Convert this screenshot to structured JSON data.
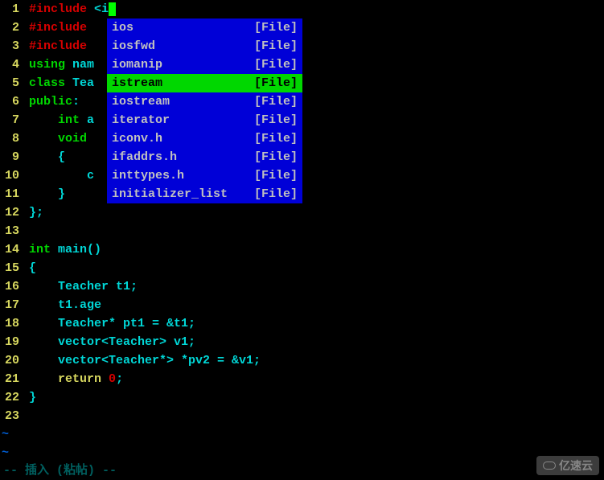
{
  "lines": [
    {
      "n": "1",
      "segments": [
        {
          "cls": "preproc",
          "t": "#include "
        },
        {
          "cls": "plain",
          "t": "<i"
        },
        {
          "cls": "cursor",
          "t": " "
        }
      ]
    },
    {
      "n": "2",
      "segments": [
        {
          "cls": "preproc",
          "t": "#include "
        }
      ]
    },
    {
      "n": "3",
      "segments": [
        {
          "cls": "preproc",
          "t": "#include "
        }
      ]
    },
    {
      "n": "4",
      "segments": [
        {
          "cls": "keyword",
          "t": "using "
        },
        {
          "cls": "identifier",
          "t": "nam"
        }
      ]
    },
    {
      "n": "5",
      "segments": [
        {
          "cls": "keyword",
          "t": "class "
        },
        {
          "cls": "identifier",
          "t": "Tea"
        }
      ]
    },
    {
      "n": "6",
      "segments": [
        {
          "cls": "keyword",
          "t": "public"
        },
        {
          "cls": "plain",
          "t": ":"
        }
      ]
    },
    {
      "n": "7",
      "segments": [
        {
          "cls": "plain",
          "t": "    "
        },
        {
          "cls": "type",
          "t": "int"
        },
        {
          "cls": "plain",
          "t": " "
        },
        {
          "cls": "identifier",
          "t": "a"
        }
      ]
    },
    {
      "n": "8",
      "segments": [
        {
          "cls": "plain",
          "t": "    "
        },
        {
          "cls": "type",
          "t": "void"
        }
      ]
    },
    {
      "n": "9",
      "segments": [
        {
          "cls": "plain",
          "t": "    {"
        }
      ]
    },
    {
      "n": "10",
      "segments": [
        {
          "cls": "plain",
          "t": "        c                       ;"
        }
      ]
    },
    {
      "n": "11",
      "segments": [
        {
          "cls": "plain",
          "t": "    }"
        }
      ]
    },
    {
      "n": "12",
      "segments": [
        {
          "cls": "plain",
          "t": "};"
        }
      ]
    },
    {
      "n": "13",
      "segments": [
        {
          "cls": "plain",
          "t": ""
        }
      ]
    },
    {
      "n": "14",
      "segments": [
        {
          "cls": "type",
          "t": "int"
        },
        {
          "cls": "plain",
          "t": " "
        },
        {
          "cls": "func",
          "t": "main"
        },
        {
          "cls": "plain",
          "t": "()"
        }
      ]
    },
    {
      "n": "15",
      "segments": [
        {
          "cls": "plain",
          "t": "{"
        }
      ]
    },
    {
      "n": "16",
      "segments": [
        {
          "cls": "plain",
          "t": "    "
        },
        {
          "cls": "identifier",
          "t": "Teacher t1;"
        }
      ]
    },
    {
      "n": "17",
      "segments": [
        {
          "cls": "plain",
          "t": "    "
        },
        {
          "cls": "identifier",
          "t": "t1.age"
        }
      ]
    },
    {
      "n": "18",
      "segments": [
        {
          "cls": "plain",
          "t": "    "
        },
        {
          "cls": "identifier",
          "t": "Teacher* pt1 = &t1;"
        }
      ]
    },
    {
      "n": "19",
      "segments": [
        {
          "cls": "plain",
          "t": "    "
        },
        {
          "cls": "identifier",
          "t": "vector<Teacher> v1;"
        }
      ]
    },
    {
      "n": "20",
      "segments": [
        {
          "cls": "plain",
          "t": "    "
        },
        {
          "cls": "identifier",
          "t": "vector<Teacher*> *pv2 = &v1;"
        }
      ]
    },
    {
      "n": "21",
      "segments": [
        {
          "cls": "plain",
          "t": "    "
        },
        {
          "cls": "return",
          "t": "return"
        },
        {
          "cls": "plain",
          "t": " "
        },
        {
          "cls": "number",
          "t": "0"
        },
        {
          "cls": "plain",
          "t": ";"
        }
      ]
    },
    {
      "n": "22",
      "segments": [
        {
          "cls": "plain",
          "t": "}"
        }
      ]
    },
    {
      "n": "23",
      "segments": [
        {
          "cls": "plain",
          "t": ""
        }
      ]
    }
  ],
  "tilde": "~",
  "status_text": "-- 插入 (粘帖) --",
  "popup": {
    "items": [
      {
        "name": "ios",
        "kind": "[File]",
        "selected": false
      },
      {
        "name": "iosfwd",
        "kind": "[File]",
        "selected": false
      },
      {
        "name": "iomanip",
        "kind": "[File]",
        "selected": false
      },
      {
        "name": "istream",
        "kind": "[File]",
        "selected": true
      },
      {
        "name": "iostream",
        "kind": "[File]",
        "selected": false
      },
      {
        "name": "iterator",
        "kind": "[File]",
        "selected": false
      },
      {
        "name": "iconv.h",
        "kind": "[File]",
        "selected": false
      },
      {
        "name": "ifaddrs.h",
        "kind": "[File]",
        "selected": false
      },
      {
        "name": "inttypes.h",
        "kind": "[File]",
        "selected": false
      },
      {
        "name": "initializer_list",
        "kind": "[File]",
        "selected": false
      }
    ]
  },
  "watermark": "亿速云"
}
